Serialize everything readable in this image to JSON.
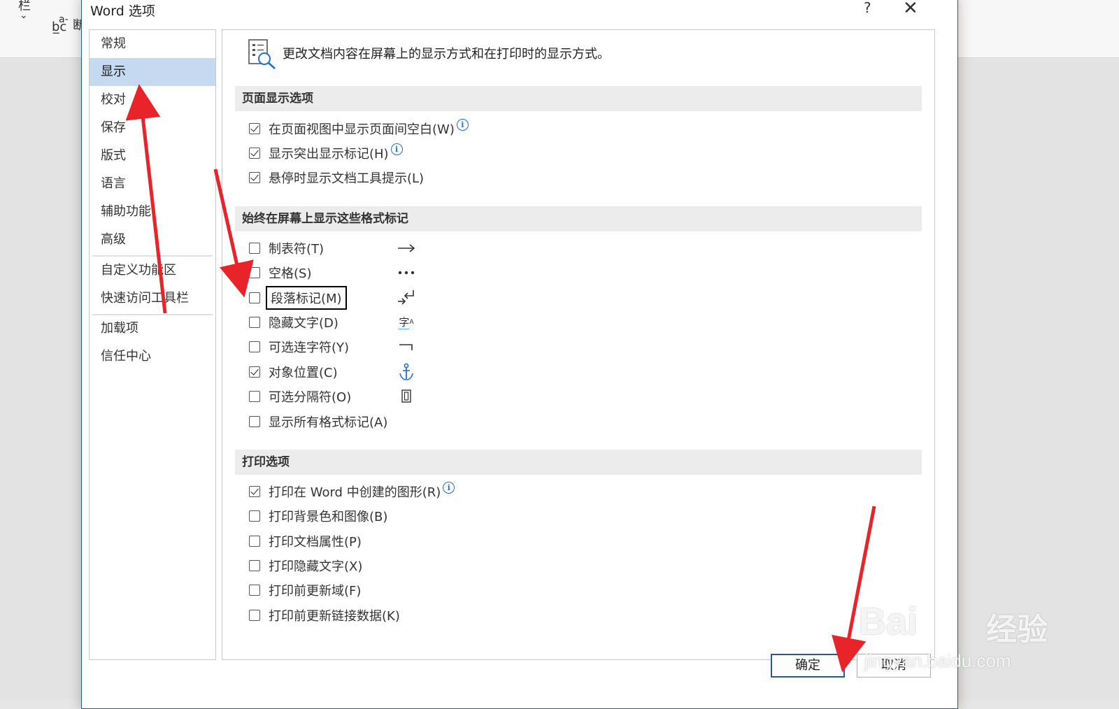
{
  "window": {
    "title": "Word 选项",
    "help_glyph": "?",
    "close_glyph": "✕"
  },
  "backdrop": {
    "ribbon_text_1": "栏",
    "ribbon_text_2": "b̲c",
    "ribbon_text_3": "a-",
    "ribbon_text_4": "断"
  },
  "sidebar": {
    "items": [
      {
        "label": "常规"
      },
      {
        "label": "显示",
        "selected": true
      },
      {
        "label": "校对"
      },
      {
        "label": "保存"
      },
      {
        "label": "版式"
      },
      {
        "label": "语言"
      },
      {
        "label": "辅助功能"
      },
      {
        "label": "高级"
      },
      {
        "label": "自定义功能区"
      },
      {
        "label": "快速访问工具栏"
      },
      {
        "label": "加载项"
      },
      {
        "label": "信任中心"
      }
    ]
  },
  "main": {
    "header_text": "更改文档内容在屏幕上的显示方式和在打印时的显示方式。",
    "sections": {
      "page_display": "页面显示选项",
      "format_marks": "始终在屏幕上显示这些格式标记",
      "print": "打印选项"
    },
    "page_display_options": [
      {
        "label": "在页面视图中显示页面间空白(W)",
        "checked": true,
        "info": "i"
      },
      {
        "label": "显示突出显示标记(H)",
        "checked": true,
        "info": "i"
      },
      {
        "label": "悬停时显示文档工具提示(L)",
        "checked": true
      }
    ],
    "format_mark_options": [
      {
        "label": "制表符(T)",
        "checked": false,
        "icon": "tab-arrow-icon"
      },
      {
        "label": "空格(S)",
        "checked": false,
        "icon": "space-dots-icon"
      },
      {
        "label": "段落标记(M)",
        "checked": false,
        "icon": "paragraph-mark-icon",
        "focused": true
      },
      {
        "label": "隐藏文字(D)",
        "checked": false,
        "icon": "hidden-text-icon",
        "icon_text": "字"
      },
      {
        "label": "可选连字符(Y)",
        "checked": false,
        "icon": "optional-hyphen-icon"
      },
      {
        "label": "对象位置(C)",
        "checked": true,
        "icon": "anchor-icon"
      },
      {
        "label": "可选分隔符(O)",
        "checked": false,
        "icon": "optional-break-icon"
      },
      {
        "label": "显示所有格式标记(A)",
        "checked": false
      }
    ],
    "print_options": [
      {
        "label": "打印在 Word 中创建的图形(R)",
        "checked": true,
        "info": "i"
      },
      {
        "label": "打印背景色和图像(B)",
        "checked": false
      },
      {
        "label": "打印文档属性(P)",
        "checked": false
      },
      {
        "label": "打印隐藏文字(X)",
        "checked": false
      },
      {
        "label": "打印前更新域(F)",
        "checked": false
      },
      {
        "label": "打印前更新链接数据(K)",
        "checked": false
      }
    ]
  },
  "buttons": {
    "ok": "确定",
    "cancel": "取消"
  },
  "colors": {
    "selected_nav": "#c5d9f1",
    "accent": "#2b579a",
    "arrow": "#e8242a",
    "info": "#1f6fd1"
  },
  "watermark": {
    "brand_a": "Bai",
    "brand_b": "经验",
    "url": "jingyan.baidu.com"
  }
}
